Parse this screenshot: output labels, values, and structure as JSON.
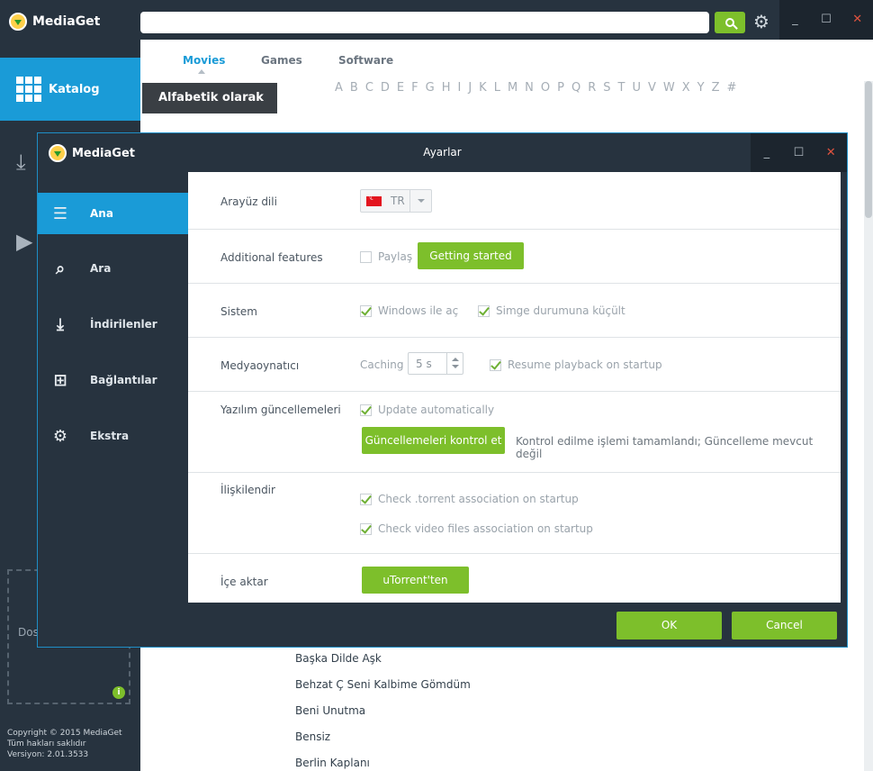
{
  "app": {
    "name": "MediaGet",
    "sidebar": {
      "katalog_label": "Katalog",
      "dropzone_text": "Dosy… için b…",
      "copyright_lines": [
        "Copyright © 2015 MediaGet",
        "Tüm hakları saklıdır",
        "Versiyon: 2.01.3533"
      ]
    },
    "topbar": {
      "search_value": "",
      "window_buttons": [
        "_",
        "☐",
        "✕"
      ]
    },
    "tabs": [
      {
        "label": "Movies",
        "active": true
      },
      {
        "label": "Games",
        "active": false
      },
      {
        "label": "Software",
        "active": false
      }
    ],
    "alpha_button": "Alfabetik olarak",
    "alphabet": [
      "A",
      "B",
      "C",
      "D",
      "E",
      "F",
      "G",
      "H",
      "I",
      "J",
      "K",
      "L",
      "M",
      "N",
      "O",
      "P",
      "Q",
      "R",
      "S",
      "T",
      "U",
      "V",
      "W",
      "X",
      "Y",
      "Z",
      "#"
    ],
    "movies": [
      "Başka Dilde Aşk",
      "Behzat Ç Seni Kalbime Gömdüm",
      "Beni Unutma",
      "Bensiz",
      "Berlin Kaplanı"
    ]
  },
  "dialog": {
    "brand": "MediaGet",
    "title": "Ayarlar",
    "window_buttons": [
      "_",
      "☐",
      "✕"
    ],
    "nav": [
      {
        "label": "Ana",
        "icon": "sliders-icon",
        "active": true
      },
      {
        "label": "Ara",
        "icon": "search-icon",
        "active": false
      },
      {
        "label": "İndirilenler",
        "icon": "download-icon",
        "active": false
      },
      {
        "label": "Bağlantılar",
        "icon": "network-icon",
        "active": false
      },
      {
        "label": "Ekstra",
        "icon": "gear-icon",
        "active": false
      }
    ],
    "rows": {
      "language": {
        "label": "Arayüz dili",
        "value": "TR"
      },
      "additional": {
        "label": "Additional features",
        "share_label": "Paylaş",
        "share_checked": false,
        "button": "Getting started"
      },
      "system": {
        "label": "Sistem",
        "startup_label": "Windows ile aç",
        "startup_checked": true,
        "minimize_label": "Simge durumuna küçült",
        "minimize_checked": true
      },
      "player": {
        "label": "Medyaoynatıcı",
        "caching_label": "Caching",
        "caching_value": "5 s",
        "resume_label": "Resume playback on startup",
        "resume_checked": true
      },
      "updates": {
        "label": "Yazılım güncellemeleri",
        "auto_label": "Update automatically",
        "auto_checked": true,
        "button": "Güncellemeleri kontrol et",
        "status": "Kontrol edilme işlemi tamamlandı; Güncelleme mevcut değil"
      },
      "associate": {
        "label": "İlişkilendir",
        "torrent_label": "Check .torrent association on startup",
        "torrent_checked": true,
        "video_label": "Check video files association on startup",
        "video_checked": true
      },
      "import": {
        "label": "İçe aktar",
        "button": "uTorrent'ten"
      }
    },
    "ok_label": "OK",
    "cancel_label": "Cancel"
  },
  "colors": {
    "accent_blue": "#1a9bd7",
    "accent_green": "#7dbf2b",
    "dark_bg": "#27333f"
  }
}
